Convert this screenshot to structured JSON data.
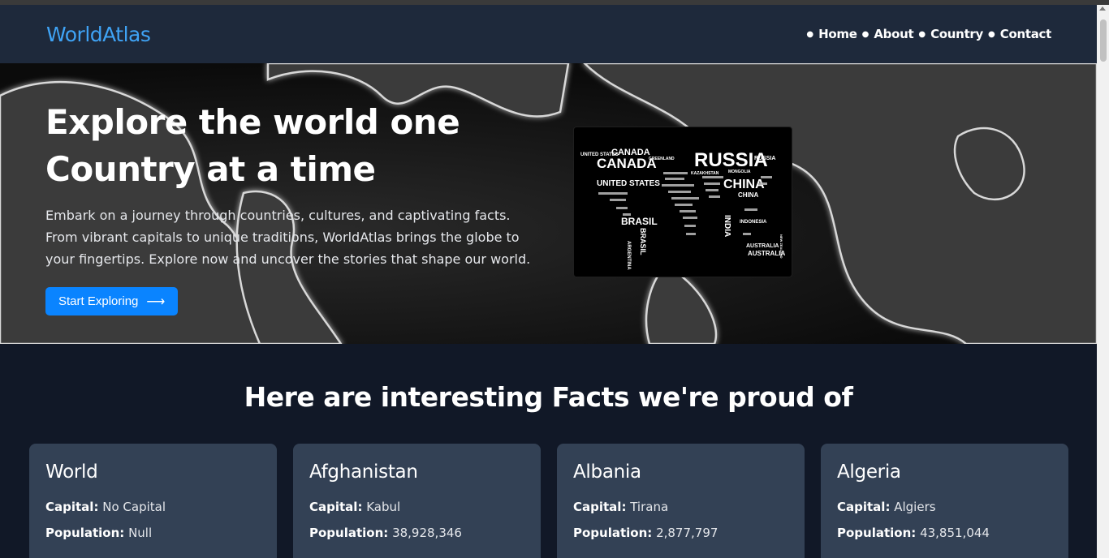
{
  "header": {
    "logo": "WorldAtlas",
    "nav": [
      "Home",
      "About",
      "Country",
      "Contact"
    ]
  },
  "hero": {
    "title_line1": "Explore the world one",
    "title_line2": "Country at a time",
    "description": "Embark on a journey through countries, cultures, and captivating facts. From vibrant capitals to unique traditions, WorldAtlas brings the globe to your fingertips. Explore now and uncover the stories that shape our world.",
    "cta_label": "Start Exploring",
    "image_words": [
      "UNITED STATES",
      "CANADA",
      "CANADA",
      "UNITED STATES",
      "GREENLAND",
      "RUSSIA",
      "RUSSIA",
      "CHINA",
      "CHINA",
      "INDIA",
      "MONGOLIA",
      "KAZAKHSTAN",
      "INDONESIA",
      "BRASIL",
      "BRASIL",
      "ARGENTINA",
      "AUSTRALIA",
      "AUSTRALIA",
      "NEW ZEALAND"
    ]
  },
  "facts": {
    "title": "Here are interesting Facts we're proud of",
    "labels": {
      "capital": "Capital:",
      "population": "Population:"
    },
    "cards": [
      {
        "name": "World",
        "capital": "No Capital",
        "population": "Null"
      },
      {
        "name": "Afghanistan",
        "capital": "Kabul",
        "population": "38,928,346"
      },
      {
        "name": "Albania",
        "capital": "Tirana",
        "population": "2,877,797"
      },
      {
        "name": "Algeria",
        "capital": "Algiers",
        "population": "43,851,044"
      }
    ]
  },
  "colors": {
    "accent": "#3fa3f5",
    "button": "#0a84ff",
    "header_bg": "#1e293b",
    "card_bg": "#334155",
    "page_bg": "#111827"
  }
}
